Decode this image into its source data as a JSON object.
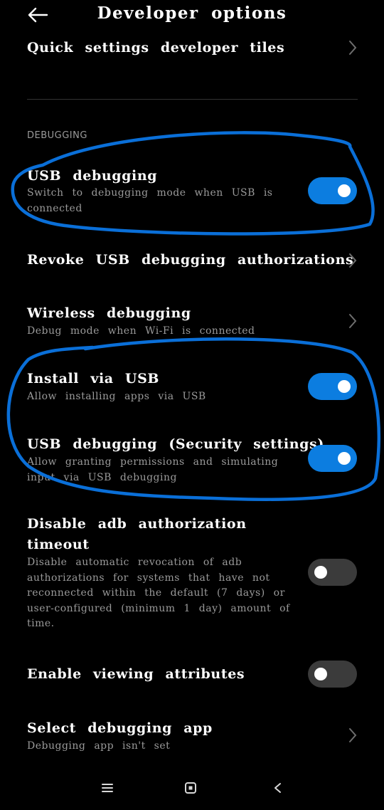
{
  "header": {
    "title": "Developer options",
    "back_icon": "back-arrow-icon"
  },
  "items": {
    "quick_settings": {
      "title": "Quick settings developer tiles"
    },
    "section_debugging": "DEBUGGING",
    "usb_debugging": {
      "title": "USB debugging",
      "subtitle": "Switch to debugging mode when USB is connected",
      "toggle_on": true
    },
    "revoke_usb": {
      "title": "Revoke USB debugging authorizations"
    },
    "wireless_debugging": {
      "title": "Wireless debugging",
      "subtitle": "Debug mode when Wi-Fi is connected"
    },
    "install_via_usb": {
      "title": "Install via USB",
      "subtitle": "Allow installing apps via USB",
      "toggle_on": true
    },
    "usb_debugging_security": {
      "title": "USB debugging (Security settings)",
      "subtitle": "Allow granting permissions and simulating input via USB debugging",
      "toggle_on": true
    },
    "disable_adb_timeout": {
      "title": "Disable adb authorization timeout",
      "subtitle": "Disable automatic revocation of adb authorizations for systems that have not reconnected within the default (7 days) or user-configured (minimum 1 day) amount of time.",
      "toggle_on": false
    },
    "enable_viewing_attributes": {
      "title": "Enable viewing attributes",
      "toggle_on": false
    },
    "select_debugging_app": {
      "title": "Select debugging app",
      "subtitle": "Debugging app isn't set"
    }
  },
  "colors": {
    "background": "#000000",
    "toggle_on": "#0c7de0",
    "toggle_off": "#3b3b3b",
    "annotation": "#0a6fd8"
  },
  "navbar": {
    "icons": [
      "menu-icon",
      "home-square-icon",
      "back-chevron-icon"
    ]
  }
}
